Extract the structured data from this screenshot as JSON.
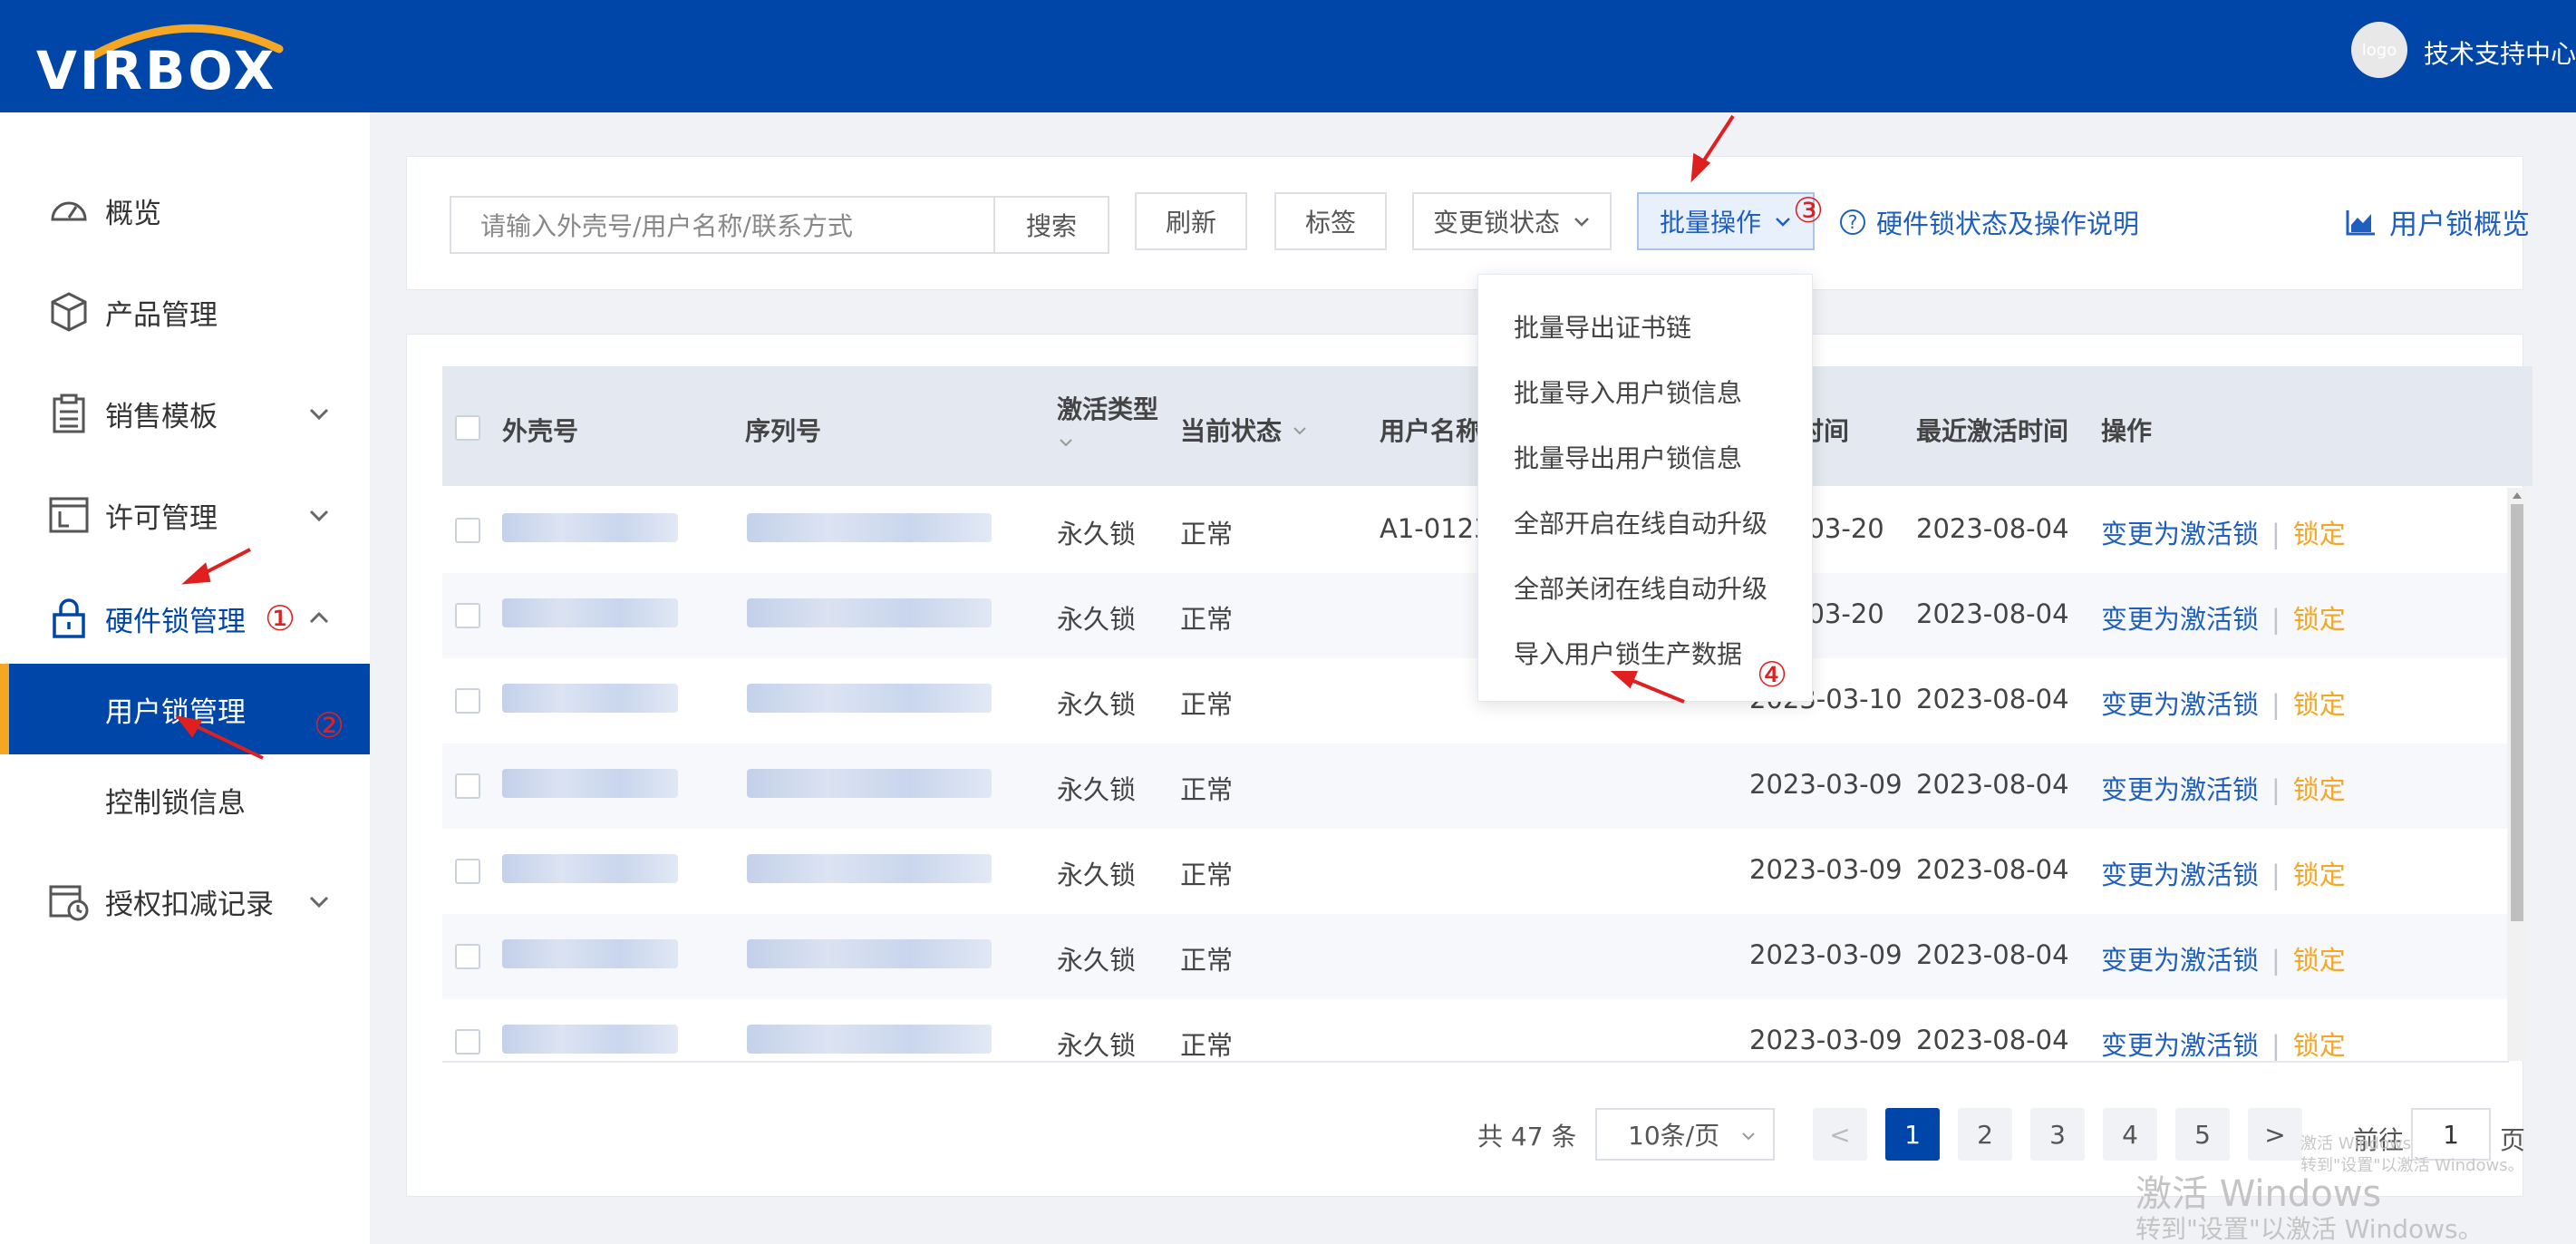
{
  "header": {
    "logo_text": "VIRBOX",
    "avatar_text": "logo",
    "user_label": "技术支持中心"
  },
  "sidebar": {
    "items": [
      {
        "label": "概览"
      },
      {
        "label": "产品管理"
      },
      {
        "label": "销售模板"
      },
      {
        "label": "许可管理"
      },
      {
        "label": "硬件锁管理"
      },
      {
        "label": "用户锁管理"
      },
      {
        "label": "控制锁信息"
      },
      {
        "label": "授权扣减记录"
      }
    ]
  },
  "toolbar": {
    "search_placeholder": "请输入外壳号/用户名称/联系方式",
    "search_label": "搜索",
    "refresh_label": "刷新",
    "tag_label": "标签",
    "change_status_label": "变更锁状态",
    "batch_label": "批量操作",
    "help_label": "硬件锁状态及操作说明",
    "overview_label": "用户锁概览"
  },
  "dropdown": {
    "items": [
      "批量导出证书链",
      "批量导入用户锁信息",
      "批量导出用户锁信息",
      "全部开启在线自动升级",
      "全部关闭在线自动升级",
      "导入用户锁生产数据"
    ]
  },
  "table": {
    "headers": {
      "shell": "外壳号",
      "serial": "序列号",
      "type": "激活类型",
      "status": "当前状态",
      "username": "用户名称",
      "time": "时间",
      "last_active": "最近激活时间",
      "ops": "操作"
    },
    "rows": [
      {
        "type": "永久锁",
        "status": "正常",
        "username": "A1-0123",
        "time": "-03-20",
        "last": "2023-08-04"
      },
      {
        "type": "永久锁",
        "status": "正常",
        "username": "",
        "time": "-03-20",
        "last": "2023-08-04"
      },
      {
        "type": "永久锁",
        "status": "正常",
        "username": "",
        "time": "2023-03-10",
        "last": "2023-08-04"
      },
      {
        "type": "永久锁",
        "status": "正常",
        "username": "",
        "time": "2023-03-09",
        "last": "2023-08-04"
      },
      {
        "type": "永久锁",
        "status": "正常",
        "username": "",
        "time": "2023-03-09",
        "last": "2023-08-04"
      },
      {
        "type": "永久锁",
        "status": "正常",
        "username": "",
        "time": "2023-03-09",
        "last": "2023-08-04"
      },
      {
        "type": "永久锁",
        "status": "正常",
        "username": "",
        "time": "2023-03-09",
        "last": "2023-08-04"
      }
    ],
    "op_activate": "变更为激活锁",
    "op_sep": "|",
    "op_lock": "锁定"
  },
  "pagination": {
    "total": "共 47 条",
    "page_size": "10条/页",
    "pages": [
      "1",
      "2",
      "3",
      "4",
      "5"
    ],
    "prev": "<",
    "next": ">",
    "goto_label": "前往",
    "goto_value": "1",
    "page_suffix": "页"
  },
  "annotations": {
    "a1": "①",
    "a2": "②",
    "a3": "③",
    "a4": "④"
  },
  "watermark": {
    "small1": "激活 Windows",
    "small2": "转到\"设置\"以激活 Windows。",
    "big1": "激活 Windows",
    "big2": "转到\"设置\"以激活 Windows。"
  },
  "colors": {
    "brand": "#0046a8",
    "accent": "#f5a623",
    "link": "#1f5fbf",
    "annotation": "#e02020"
  }
}
